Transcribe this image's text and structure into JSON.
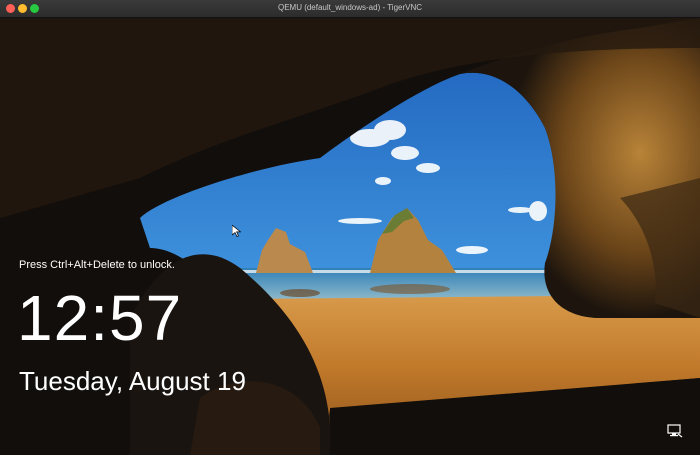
{
  "window": {
    "title": "QEMU (default_windows-ad) - TigerVNC",
    "controls": [
      "close",
      "minimize",
      "zoom"
    ]
  },
  "lock_screen": {
    "unlock_hint": "Press Ctrl+Alt+Delete to unlock.",
    "time": "12:57",
    "date": "Tuesday, August 19"
  },
  "icons": {
    "network": "network-icon",
    "cursor": "mouse-pointer-icon"
  },
  "colors": {
    "sky_top": "#1f66c0",
    "sky_bottom": "#52a5e6",
    "sand": "#c9842f",
    "cave_dark": "#120e0b",
    "rock_lit": "#a8742d"
  }
}
